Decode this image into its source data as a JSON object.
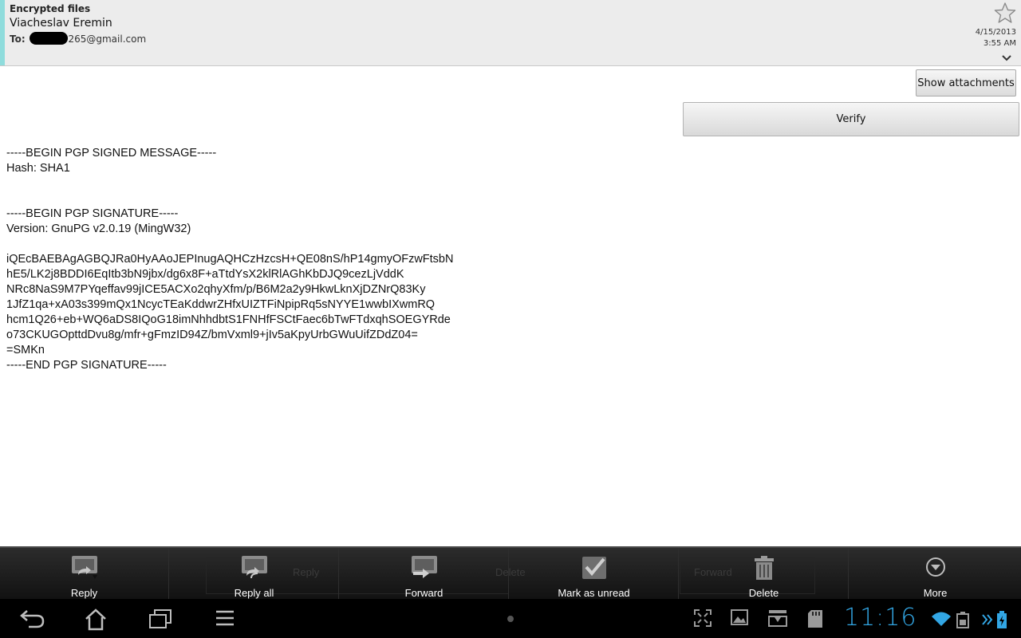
{
  "header": {
    "subject": "Encrypted files",
    "sender": "Viacheslav Eremin",
    "to_label": "To:",
    "to_address_visible": "265@gmail.com",
    "date": "4/15/2013",
    "time": "3:55 AM",
    "accent_color": "#8fdcdc"
  },
  "buttons": {
    "show_attachments": "Show attachments",
    "verify": "Verify"
  },
  "body": {
    "lines": [
      "-----BEGIN PGP SIGNED MESSAGE-----",
      "Hash: SHA1",
      "",
      "",
      "-----BEGIN PGP SIGNATURE-----",
      "Version: GnuPG v2.0.19 (MingW32)",
      "",
      "iQEcBAEBAgAGBQJRa0HyAAoJEPInugAQHCzHzcsH+QE08nS/hP14gmyOFzwFtsbN",
      "hE5/LK2j8BDDI6EqItb3bN9jbx/dg6x8F+aTtdYsX2klRlAGhKbDJQ9cezLjVddK",
      "NRc8NaS9M7PYqeffav99jICE5ACXo2qhyXfm/p/B6M2a2y9HkwLknXjDZNrQ83Ky",
      "1JfZ1qa+xA03s399mQx1NcycTEaKddwrZHfxUIZTFiNpipRq5sNYYE1wwbIXwmRQ",
      "hcm1Q26+eb+WQ6aDS8IQoG18imNhhdbtS1FNHfFSCtFaec6bTwFTdxqhSOEGYRde",
      "o73CKUGOpttdDvu8g/mfr+gFmzID94Z/bmVxml9+jIv5aKpyUrbGWuUifZDdZ04=",
      "=SMKn",
      "-----END PGP SIGNATURE-----"
    ]
  },
  "action_bar": {
    "items": [
      {
        "label": "Reply",
        "icon": "reply-icon"
      },
      {
        "label": "Reply all",
        "icon": "reply-all-icon"
      },
      {
        "label": "Forward",
        "icon": "forward-icon"
      },
      {
        "label": "Mark as unread",
        "icon": "mark-unread-icon"
      },
      {
        "label": "Delete",
        "icon": "trash-icon"
      },
      {
        "label": "More",
        "icon": "more-icon"
      }
    ],
    "ghost_labels": [
      "Reply",
      "Delete",
      "Forward"
    ]
  },
  "system_bar": {
    "clock": "11:16",
    "clock_color": "#32a6e4",
    "icons": [
      "back-icon",
      "home-icon",
      "recent-apps-icon",
      "menu-icon",
      "fullscreen-icon",
      "gallery-icon",
      "download-icon",
      "sd-card-icon",
      "wifi-icon",
      "keyboard-icon",
      "more-notifications-icon",
      "battery-icon"
    ]
  }
}
